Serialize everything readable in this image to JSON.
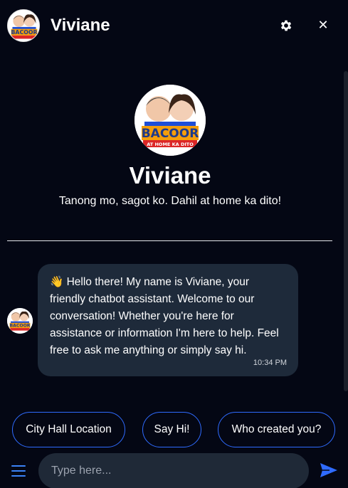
{
  "header": {
    "title": "Viviane",
    "settings_icon": "gear-icon",
    "close_glyph": "✕"
  },
  "intro": {
    "name": "Viviane",
    "tagline": "Tanong mo, sagot ko. Dahil at home ka dito!"
  },
  "avatar": {
    "logo_text": "BACOOR",
    "logo_subtext": "AT HOME KA DITO"
  },
  "message": {
    "text": "👋 Hello there! My name is Viviane, your friendly chatbot assistant. Welcome to our conversation! Whether you're here for assistance or information I'm here to help. Feel free to ask me anything or simply say hi.",
    "time": "10:34 PM"
  },
  "quick_replies": [
    "City Hall Location",
    "Say Hi!",
    "Who created you?"
  ],
  "composer": {
    "placeholder": "Type here...",
    "menu_icon": "hamburger-menu-icon",
    "send_icon": "send-icon"
  },
  "colors": {
    "background": "#040714",
    "bubble": "#1e2a3a",
    "accent": "#2f6bff",
    "input": "#1f2937"
  }
}
